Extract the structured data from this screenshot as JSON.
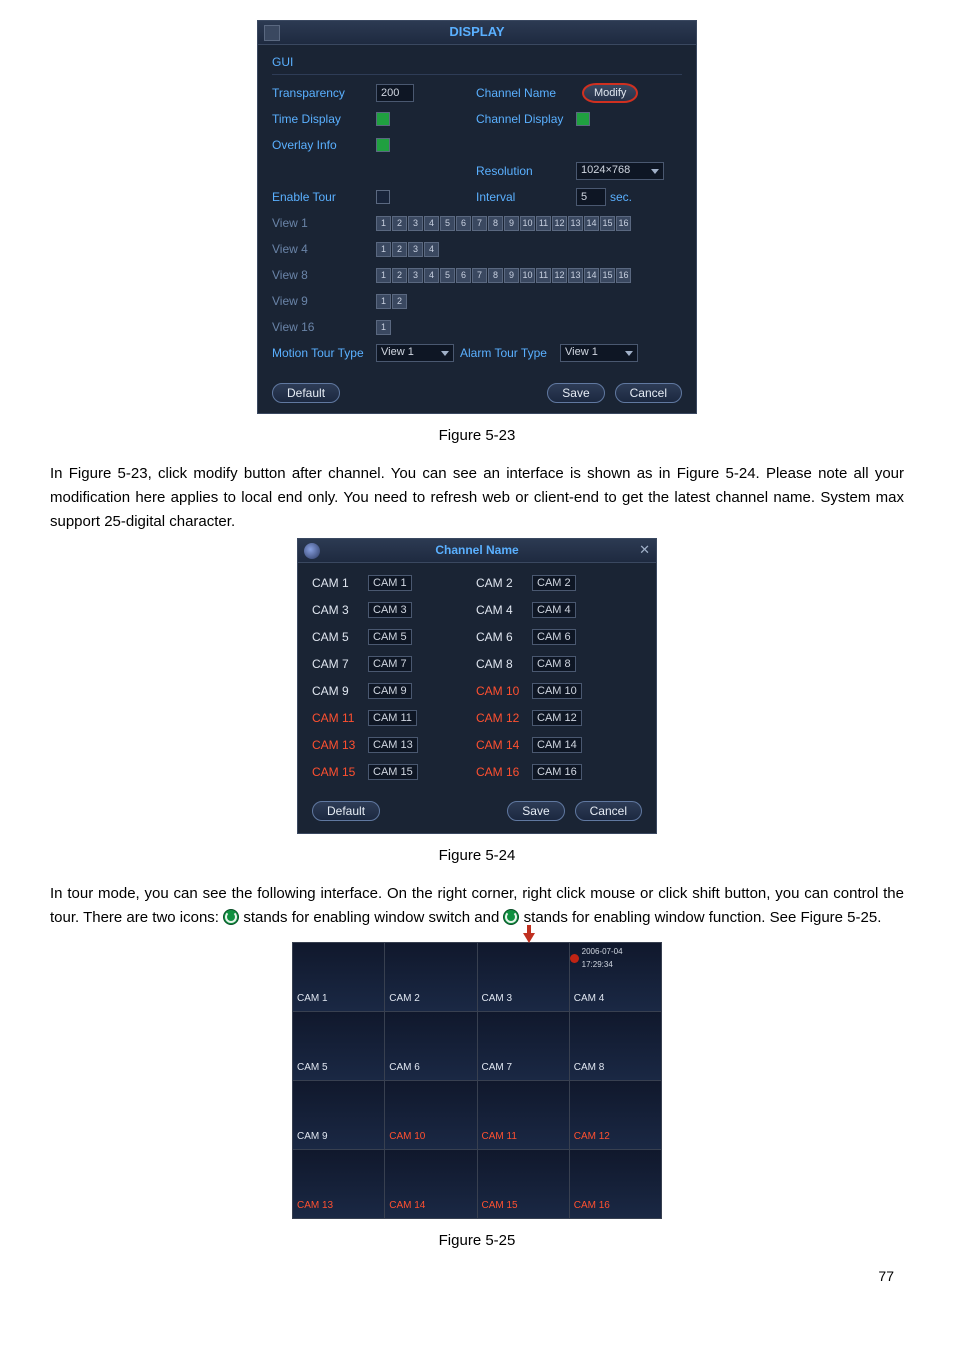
{
  "figure1": {
    "title": "DISPLAY",
    "section": "GUI",
    "labels": {
      "transparency": "Transparency",
      "time_display": "Time Display",
      "overlay_info": "Overlay Info",
      "channel_name": "Channel Name",
      "channel_display": "Channel Display",
      "resolution": "Resolution",
      "enable_tour": "Enable Tour",
      "interval": "Interval",
      "view1": "View 1",
      "view4": "View 4",
      "view8": "View 8",
      "view9": "View 9",
      "view16": "View 16",
      "motion_tour_type": "Motion Tour Type",
      "alarm_tour_type": "Alarm Tour Type"
    },
    "values": {
      "transparency": "200",
      "resolution": "1024×768",
      "interval": "5",
      "interval_unit": "sec.",
      "motion_tour": "View 1",
      "alarm_tour": "View 1"
    },
    "view_counts": {
      "view1": 16,
      "view4": 4,
      "view8": 16,
      "view9": 2,
      "view16": 1
    },
    "buttons": {
      "modify": "Modify",
      "default": "Default",
      "save": "Save",
      "cancel": "Cancel"
    }
  },
  "caption1": "Figure 5-23",
  "para1": "In Figure 5-23, click modify button after channel. You can see an interface is shown as in Figure 5-24. Please note all your modification here applies to local end only. You need to refresh web or client-end to get the latest channel name. System max support 25-digital character.",
  "figure2": {
    "title": "Channel Name",
    "rows": [
      {
        "l1": "CAM 1",
        "v1": "CAM 1",
        "l2": "CAM 2",
        "v2": "CAM 2",
        "red": false
      },
      {
        "l1": "CAM 3",
        "v1": "CAM 3",
        "l2": "CAM 4",
        "v2": "CAM 4",
        "red": false
      },
      {
        "l1": "CAM 5",
        "v1": "CAM 5",
        "l2": "CAM 6",
        "v2": "CAM 6",
        "red": false
      },
      {
        "l1": "CAM 7",
        "v1": "CAM 7",
        "l2": "CAM 8",
        "v2": "CAM 8",
        "red": false
      },
      {
        "l1": "CAM 9",
        "v1": "CAM 9",
        "l2": "CAM 10",
        "v2": "CAM 10",
        "red2": true
      },
      {
        "l1": "CAM 11",
        "v1": "CAM 11",
        "l2": "CAM 12",
        "v2": "CAM 12",
        "red": true
      },
      {
        "l1": "CAM 13",
        "v1": "CAM 13",
        "l2": "CAM 14",
        "v2": "CAM 14",
        "red": true
      },
      {
        "l1": "CAM 15",
        "v1": "CAM 15",
        "l2": "CAM 16",
        "v2": "CAM 16",
        "red": true
      }
    ],
    "buttons": {
      "default": "Default",
      "save": "Save",
      "cancel": "Cancel"
    }
  },
  "caption2": "Figure 5-24",
  "para2a": "In tour mode, you can see the following interface. On the right corner, right click mouse or click shift button, you can control the tour. There are two icons: ",
  "para2b": " stands for enabling window switch and ",
  "para2c": " stands for enabling window function. See Figure 5-25.",
  "figure3": {
    "timestamp": "2006-07-04 17:29:34",
    "cells": [
      "CAM 1",
      "CAM 2",
      "CAM 3",
      "CAM 4",
      "CAM 5",
      "CAM 6",
      "CAM 7",
      "CAM 8",
      "CAM 9",
      "CAM 10",
      "CAM 11",
      "CAM 12",
      "CAM 13",
      "CAM 14",
      "CAM 15",
      "CAM 16"
    ],
    "red_indices": [
      9,
      10,
      11,
      12,
      13,
      14,
      15
    ]
  },
  "caption3": "Figure 5-25",
  "page_number": "77"
}
